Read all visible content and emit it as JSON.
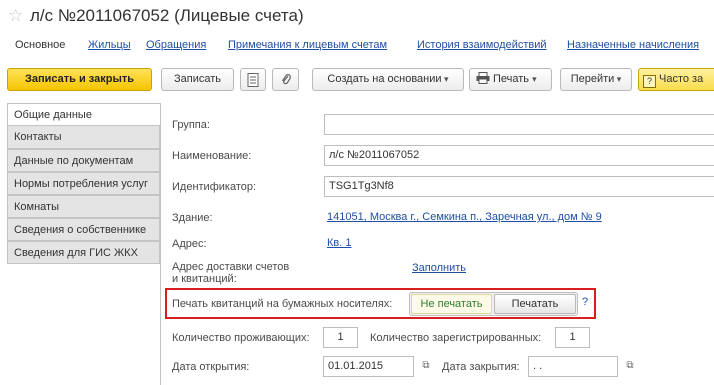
{
  "window": {
    "title": "л/с №2011067052 (Лицевые счета)"
  },
  "nav": {
    "items": [
      "Основное",
      "Жильцы",
      "Обращения",
      "Примечания к лицевым счетам",
      "История взаимодействий",
      "Назначенные начисления"
    ]
  },
  "toolbar": {
    "save_close": "Записать и закрыть",
    "save": "Записать",
    "create_based": "Создать на основании",
    "print": "Печать",
    "go": "Перейти",
    "faq": "Часто за"
  },
  "tabs": [
    "Общие данные",
    "Контакты",
    "Данные по документам",
    "Нормы потребления услуг",
    "Комнаты",
    "Сведения о собственнике",
    "Сведения для ГИС ЖКХ"
  ],
  "form": {
    "group_label": "Группа:",
    "group_value": "",
    "name_label": "Наименование:",
    "name_value": "л/с №2011067052",
    "id_label": "Идентификатор:",
    "id_value": "TSG1Tg3Nf8",
    "building_label": "Здание:",
    "building_value": "141051, Москва г., Семкина п., Заречная ул., дом № 9",
    "address_label": "Адрес:",
    "address_value": "Кв. 1",
    "delivery_label_1": "Адрес доставки счетов",
    "delivery_label_2": "и квитанций:",
    "delivery_link": "Заполнить",
    "paper_label": "Печать квитанций на бумажных носителях:",
    "paper_option_off": "Не печатать",
    "paper_option_on": "Печатать",
    "paper_selected": "Не печатать",
    "help": "?",
    "residents_label": "Количество проживающих:",
    "residents_value": "1",
    "registered_label": "Количество зарегистрированных:",
    "registered_value": "1",
    "open_label": "Дата открытия:",
    "open_value": "01.01.2015",
    "close_label": "Дата закрытия:",
    "close_value": " .  ."
  }
}
